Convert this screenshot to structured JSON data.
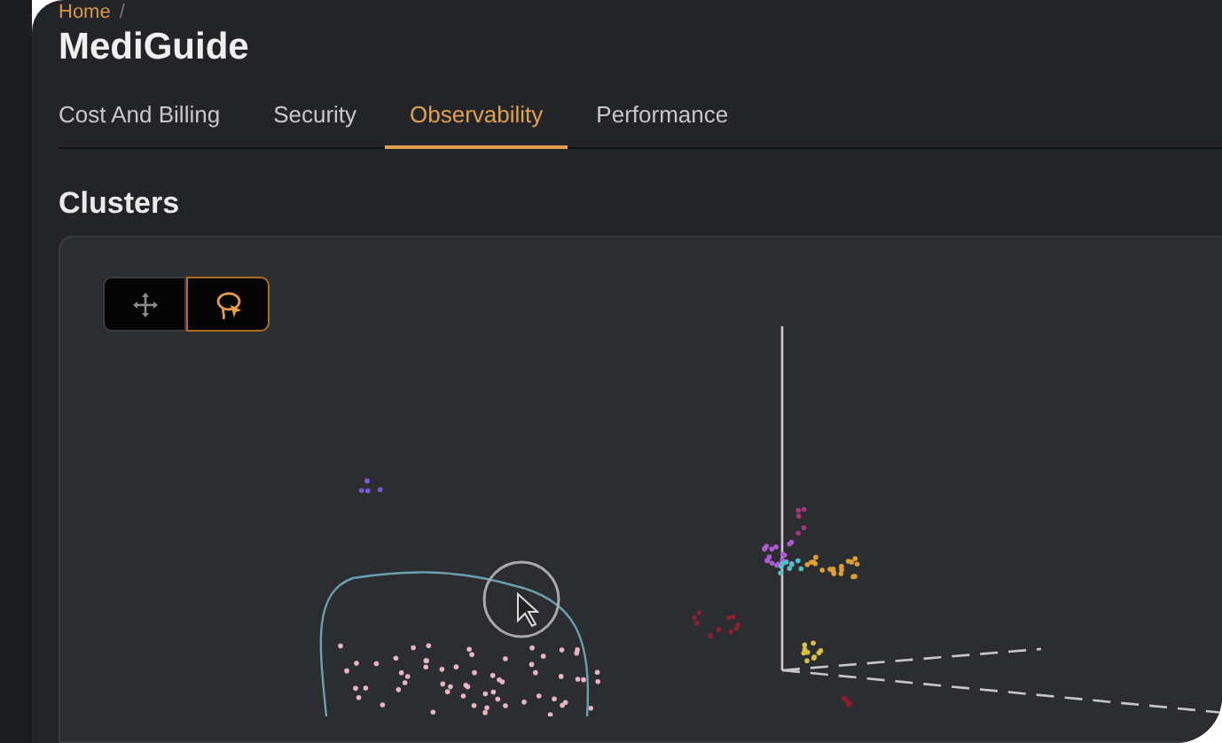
{
  "breadcrumb": {
    "items": [
      "Home"
    ],
    "separator": "/"
  },
  "title": "MediGuide",
  "tabs": [
    {
      "label": "Cost And Billing",
      "selected": false
    },
    {
      "label": "Security",
      "selected": false
    },
    {
      "label": "Observability",
      "selected": true
    },
    {
      "label": "Performance",
      "selected": false
    }
  ],
  "section_title": "Clusters",
  "tools": [
    {
      "kind": "pan",
      "selected": false
    },
    {
      "kind": "lasso",
      "selected": true
    }
  ]
}
